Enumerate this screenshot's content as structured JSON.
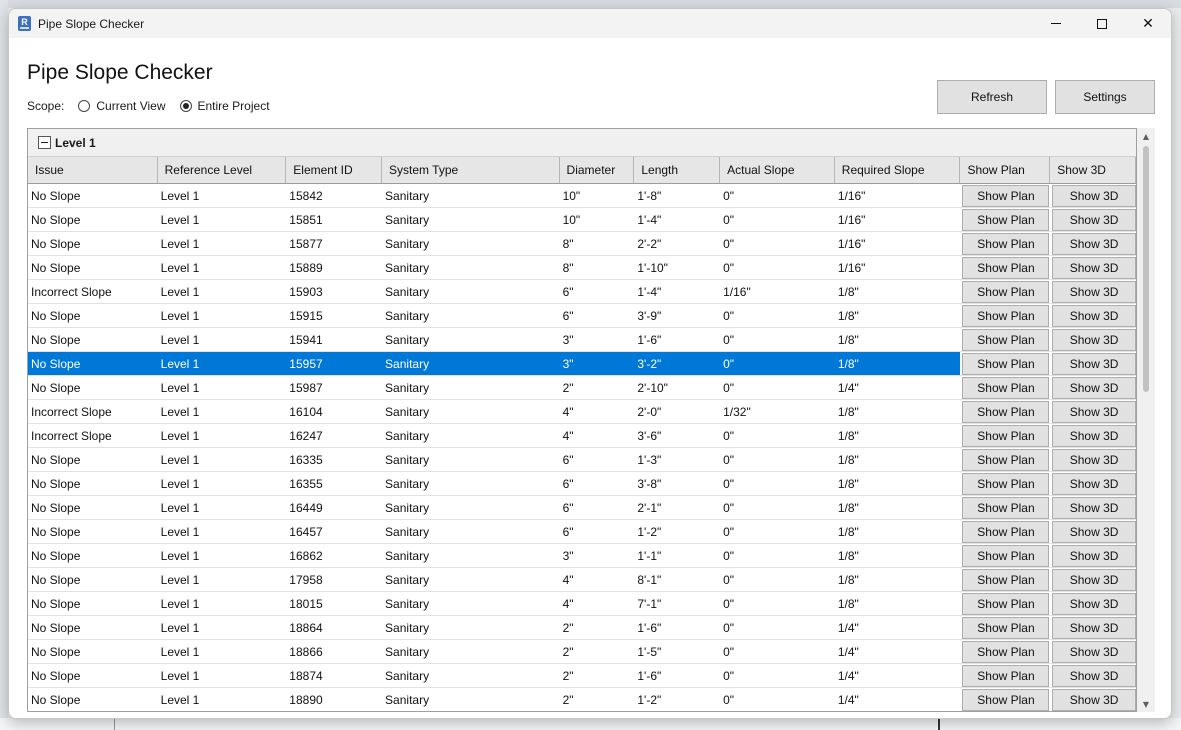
{
  "window": {
    "title": "Pipe Slope Checker",
    "app_icon": "revit-icon",
    "controls": [
      "minimize",
      "maximize",
      "close"
    ]
  },
  "header": {
    "title": "Pipe Slope Checker",
    "scope_label": "Scope:",
    "scope_options": [
      {
        "label": "Current View",
        "selected": false
      },
      {
        "label": "Entire Project",
        "selected": true
      }
    ],
    "refresh_label": "Refresh",
    "settings_label": "Settings"
  },
  "grid": {
    "group_label": "Level 1",
    "columns": [
      "Issue",
      "Reference Level",
      "Element ID",
      "System Type",
      "Diameter",
      "Length",
      "Actual Slope",
      "Required Slope",
      "Show Plan",
      "Show 3D"
    ],
    "show_plan_label": "Show Plan",
    "show_3d_label": "Show 3D",
    "selected_row": 7,
    "rows": [
      [
        "No Slope",
        "Level 1",
        "15842",
        "Sanitary",
        "10\"",
        "1'-8\"",
        "0\"",
        "1/16\""
      ],
      [
        "No Slope",
        "Level 1",
        "15851",
        "Sanitary",
        "10\"",
        "1'-4\"",
        "0\"",
        "1/16\""
      ],
      [
        "No Slope",
        "Level 1",
        "15877",
        "Sanitary",
        "8\"",
        "2'-2\"",
        "0\"",
        "1/16\""
      ],
      [
        "No Slope",
        "Level 1",
        "15889",
        "Sanitary",
        "8\"",
        "1'-10\"",
        "0\"",
        "1/16\""
      ],
      [
        "Incorrect Slope",
        "Level 1",
        "15903",
        "Sanitary",
        "6\"",
        "1'-4\"",
        "1/16\"",
        "1/8\""
      ],
      [
        "No Slope",
        "Level 1",
        "15915",
        "Sanitary",
        "6\"",
        "3'-9\"",
        "0\"",
        "1/8\""
      ],
      [
        "No Slope",
        "Level 1",
        "15941",
        "Sanitary",
        "3\"",
        "1'-6\"",
        "0\"",
        "1/8\""
      ],
      [
        "No Slope",
        "Level 1",
        "15957",
        "Sanitary",
        "3\"",
        "3'-2\"",
        "0\"",
        "1/8\""
      ],
      [
        "No Slope",
        "Level 1",
        "15987",
        "Sanitary",
        "2\"",
        "2'-10\"",
        "0\"",
        "1/4\""
      ],
      [
        "Incorrect Slope",
        "Level 1",
        "16104",
        "Sanitary",
        "4\"",
        "2'-0\"",
        "1/32\"",
        "1/8\""
      ],
      [
        "Incorrect Slope",
        "Level 1",
        "16247",
        "Sanitary",
        "4\"",
        "3'-6\"",
        "0\"",
        "1/8\""
      ],
      [
        "No Slope",
        "Level 1",
        "16335",
        "Sanitary",
        "6\"",
        "1'-3\"",
        "0\"",
        "1/8\""
      ],
      [
        "No Slope",
        "Level 1",
        "16355",
        "Sanitary",
        "6\"",
        "3'-8\"",
        "0\"",
        "1/8\""
      ],
      [
        "No Slope",
        "Level 1",
        "16449",
        "Sanitary",
        "6\"",
        "2'-1\"",
        "0\"",
        "1/8\""
      ],
      [
        "No Slope",
        "Level 1",
        "16457",
        "Sanitary",
        "6\"",
        "1'-2\"",
        "0\"",
        "1/8\""
      ],
      [
        "No Slope",
        "Level 1",
        "16862",
        "Sanitary",
        "3\"",
        "1'-1\"",
        "0\"",
        "1/8\""
      ],
      [
        "No Slope",
        "Level 1",
        "17958",
        "Sanitary",
        "4\"",
        "8'-1\"",
        "0\"",
        "1/8\""
      ],
      [
        "No Slope",
        "Level 1",
        "18015",
        "Sanitary",
        "4\"",
        "7'-1\"",
        "0\"",
        "1/8\""
      ],
      [
        "No Slope",
        "Level 1",
        "18864",
        "Sanitary",
        "2\"",
        "1'-6\"",
        "0\"",
        "1/4\""
      ],
      [
        "No Slope",
        "Level 1",
        "18866",
        "Sanitary",
        "2\"",
        "1'-5\"",
        "0\"",
        "1/4\""
      ],
      [
        "No Slope",
        "Level 1",
        "18874",
        "Sanitary",
        "2\"",
        "1'-6\"",
        "0\"",
        "1/4\""
      ],
      [
        "No Slope",
        "Level 1",
        "18890",
        "Sanitary",
        "2\"",
        "1'-2\"",
        "0\"",
        "1/4\""
      ]
    ]
  },
  "colors": {
    "selection": "#0078d7",
    "button_bg": "#e1e1e1",
    "header_bg": "#e6e6e6"
  }
}
